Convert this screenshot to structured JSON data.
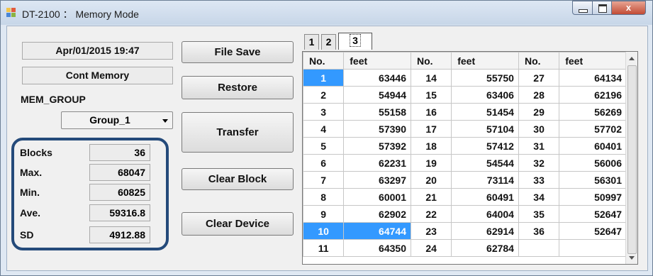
{
  "window": {
    "title": "DT-2100 ： Memory Mode",
    "close_label": "x"
  },
  "left": {
    "datetime": "Apr/01/2015 19:47",
    "mode": "Cont Memory",
    "group_label": "MEM_GROUP",
    "group_value": "Group_1",
    "stats": [
      {
        "key": "Blocks",
        "value": "36"
      },
      {
        "key": "Max.",
        "value": "68047"
      },
      {
        "key": "Min.",
        "value": "60825"
      },
      {
        "key": "Ave.",
        "value": "59316.8"
      },
      {
        "key": "SD",
        "value": "4912.88"
      }
    ]
  },
  "buttons": {
    "file_save": "File Save",
    "restore": "Restore",
    "transfer": "Transfer",
    "clear_block": "Clear Block",
    "clear_device": "Clear Device"
  },
  "tabs": [
    "1",
    "2",
    "3"
  ],
  "table": {
    "headers": [
      "No.",
      "feet",
      "No.",
      "feet",
      "No.",
      "feet"
    ],
    "rows": [
      [
        "1",
        "63446",
        "14",
        "55750",
        "27",
        "64134"
      ],
      [
        "2",
        "54944",
        "15",
        "63406",
        "28",
        "62196"
      ],
      [
        "3",
        "55158",
        "16",
        "51454",
        "29",
        "56269"
      ],
      [
        "4",
        "57390",
        "17",
        "57104",
        "30",
        "57702"
      ],
      [
        "5",
        "57392",
        "18",
        "57412",
        "31",
        "60401"
      ],
      [
        "6",
        "62231",
        "19",
        "54544",
        "32",
        "56006"
      ],
      [
        "7",
        "63297",
        "20",
        "73114",
        "33",
        "56301"
      ],
      [
        "8",
        "60001",
        "21",
        "60491",
        "34",
        "50997"
      ],
      [
        "9",
        "62902",
        "22",
        "64004",
        "35",
        "52647"
      ],
      [
        "10",
        "64744",
        "23",
        "62914",
        "36",
        "52647"
      ],
      [
        "11",
        "64350",
        "24",
        "62784",
        "",
        ""
      ]
    ]
  },
  "colors": {
    "selection": "#3399ff",
    "stats_border": "#244a7a"
  }
}
